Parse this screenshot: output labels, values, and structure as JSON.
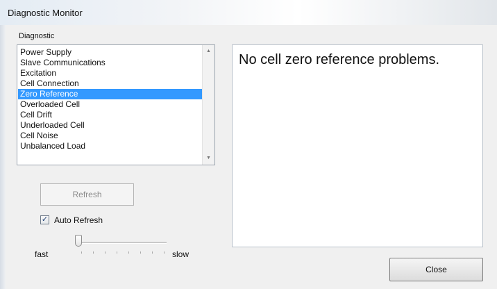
{
  "window": {
    "title": "Diagnostic Monitor"
  },
  "diagnostic": {
    "group_label": "Diagnostic",
    "items": [
      "Power Supply",
      "Slave Communications",
      "Excitation",
      "Cell Connection",
      "Zero Reference",
      "Overloaded Cell",
      "Cell Drift",
      "Underloaded Cell",
      "Cell Noise",
      "Unbalanced Load"
    ],
    "selected": "Zero Reference"
  },
  "message": {
    "text": "No cell zero reference problems."
  },
  "controls": {
    "refresh_label": "Refresh",
    "refresh_enabled": false,
    "auto_refresh_label": "Auto Refresh",
    "auto_refresh_checked": true,
    "speed_min_label": "fast",
    "speed_max_label": "slow",
    "speed_fraction": 0.0,
    "close_label": "Close"
  },
  "icons": {
    "scroll_up": "scroll-up-arrow-icon",
    "scroll_down": "scroll-down-arrow-icon",
    "checkmark": "checkmark-icon"
  }
}
